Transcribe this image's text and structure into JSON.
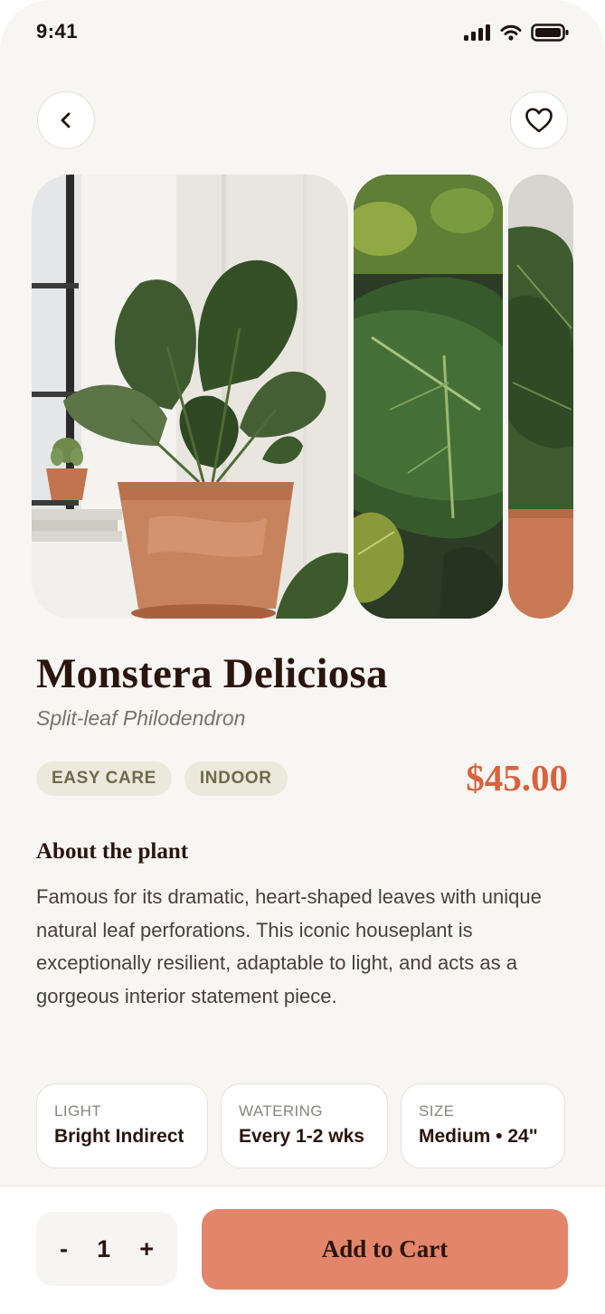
{
  "status_bar": {
    "time": "9:41"
  },
  "product": {
    "name": "Monstera Deliciosa",
    "subtitle": "Split-leaf Philodendron",
    "tags": [
      "EASY CARE",
      "INDOOR"
    ],
    "price": "$45.00"
  },
  "about": {
    "heading": "About the plant",
    "text": "Famous for its dramatic, heart-shaped leaves with unique natural leaf perforations. This iconic houseplant is exceptionally resilient, adaptable to light, and acts as a gorgeous interior statement piece."
  },
  "specs": [
    {
      "label": "LIGHT",
      "value": "Bright Indirect"
    },
    {
      "label": "WATERING",
      "value": "Every 1-2 wks"
    },
    {
      "label": "SIZE",
      "value": "Medium • 24\""
    }
  ],
  "cart": {
    "minus": "-",
    "quantity": "1",
    "plus": "+",
    "button_label": "Add to Cart"
  },
  "icons": {
    "back": "chevron-left-icon",
    "favorite": "heart-icon",
    "signal": "signal-icon",
    "wifi": "wifi-icon",
    "battery": "battery-icon"
  },
  "colors": {
    "accent": "#d9623f",
    "button": "#e2856a",
    "tag_bg": "#ebe8dc",
    "background": "#f8f6f2"
  }
}
